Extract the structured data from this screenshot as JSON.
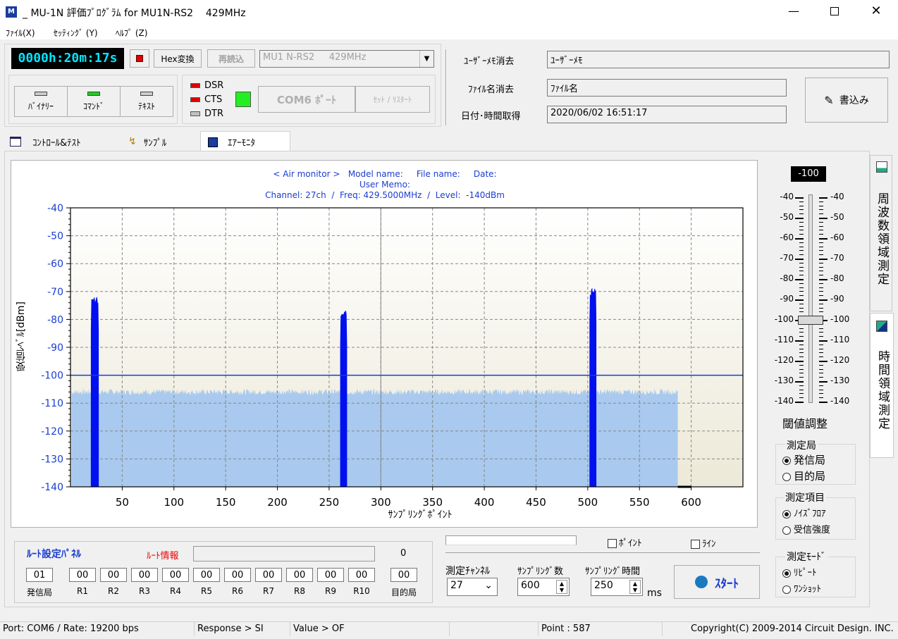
{
  "window": {
    "title": "_ MU-1N 評価ﾌﾟﾛｸﾞﾗﾑ for MU1N-RS2    429MHz"
  },
  "menu": [
    "ﾌｧｲﾙ(X)",
    "ｾｯﾃｨﾝｸﾞ (Y)",
    "ﾍﾙﾌﾟ (Z)"
  ],
  "toolbar": {
    "timer": "0000h:20m:17s",
    "hex_label": "Hex変換",
    "reload_label": "再読込",
    "device_select": "MU1 N-RS2     429MHz"
  },
  "modes": [
    {
      "label": "ﾊﾞｲﾅﾘｰ",
      "color": "#cccccc"
    },
    {
      "label": "ｺﾏﾝﾄﾞ",
      "color": "#22cc22"
    },
    {
      "label": "ﾃｷｽﾄ",
      "color": "#cccccc"
    }
  ],
  "signals": [
    {
      "label": "DSR",
      "color": "#dd0000"
    },
    {
      "label": "CTS",
      "color": "#dd0000"
    },
    {
      "label": "DTR",
      "color": "#c0c0c0"
    }
  ],
  "port": {
    "com_label": "COM6 ﾎﾟｰﾄ",
    "reset_label": "ｾｯﾄ / ﾘｽﾀｰﾄ",
    "cts_indicator": "#22ee22"
  },
  "info": {
    "memo_clear": "ﾕｰｻﾞｰﾒﾓ消去",
    "memo_value": "ﾕｰｻﾞｰﾒﾓ",
    "file_clear": "ﾌｧｲﾙ名消去",
    "file_value": "ﾌｧｲﾙ名",
    "date_label": "日付･時間取得",
    "date_value": "2020/06/02 16:51:17",
    "write_label": "書込み"
  },
  "tabs": [
    "ｺﾝﾄﾛｰﾙ&ﾃｽﾄ",
    "ｻﾝﾌﾟﾙ",
    "ｴｱｰﾓﾆﾀ"
  ],
  "side_tabs": [
    "周波数領域測定",
    "時間領域測定"
  ],
  "chart_data": {
    "type": "bar",
    "header_line1": "< Air monitor >   Model name:     File name:     Date:",
    "header_line2": "User Memo:",
    "header_line3": "Channel: 27ch  /  Freq: 429.5000MHz  /  Level:  -140dBm",
    "ylabel": "受信ﾚﾍﾞﾙ[dBm]",
    "xlabel": "ｻﾝﾌﾟﾘﾝｸﾞﾎﾟｲﾝﾄ",
    "ylim": [
      -140,
      -40
    ],
    "xlim": [
      0,
      650
    ],
    "yticks": [
      "-40",
      "-50",
      "-60",
      "-70",
      "-80",
      "-90",
      "-100",
      "-110",
      "-120",
      "-130",
      "-140"
    ],
    "xticks": [
      "50",
      "100",
      "150",
      "200",
      "250",
      "300",
      "350",
      "400",
      "450",
      "500",
      "550",
      "600"
    ],
    "threshold": -100,
    "noise_range": [
      1,
      587
    ],
    "noise_floor": -106,
    "peaks": [
      {
        "x": [
          20,
          27
        ],
        "level": -72
      },
      {
        "x": [
          261,
          267
        ],
        "level": -77
      },
      {
        "x": [
          502,
          508
        ],
        "level": -69
      }
    ]
  },
  "threshold": {
    "value": "-100",
    "ticks": [
      "-40",
      "-50",
      "-60",
      "-70",
      "-80",
      "-90",
      "-100",
      "-110",
      "-120",
      "-130",
      "-140"
    ],
    "label": "閾値調整"
  },
  "station": {
    "title": "測定局",
    "options": [
      "発信局",
      "目的局"
    ]
  },
  "item": {
    "title": "測定項目",
    "options": [
      "ﾉｲｽﾞﾌﾛｱ",
      "受信強度"
    ]
  },
  "mode": {
    "title": "測定ﾓｰﾄﾞ",
    "options": [
      "ﾘﾋﾟｰﾄ",
      "ﾜﾝｼｮｯﾄ"
    ]
  },
  "route": {
    "title": "ﾙｰﾄ設定ﾊﾟﾈﾙ",
    "info_label": "ﾙｰﾄ情報",
    "count": "0",
    "src": "01",
    "src_label": "発信局",
    "relays": [
      "00",
      "00",
      "00",
      "00",
      "00",
      "00",
      "00",
      "00",
      "00",
      "00"
    ],
    "relay_labels": [
      "R1",
      "R2",
      "R3",
      "R4",
      "R5",
      "R6",
      "R7",
      "R8",
      "R9",
      "R10"
    ],
    "dst": "00",
    "dst_label": "目的局"
  },
  "measure": {
    "point_label": "ﾎﾟｲﾝﾄ",
    "line_label": "ﾗｲﾝ",
    "channel_label": "測定ﾁｬﾝﾈﾙ",
    "channel_value": "27",
    "count_label": "ｻﾝﾌﾟﾘﾝｸﾞ数",
    "count_value": "600",
    "time_label": "ｻﾝﾌﾟﾘﾝｸﾞ時間",
    "time_value": "250",
    "ms": "ms",
    "start_label": "ｽﾀｰﾄ"
  },
  "status": [
    "Port: COM6 / Rate: 19200 bps",
    "Response > SI",
    "Value > OF",
    "",
    "Point : 587",
    "Copyright(C) 2009-2014 Circuit Design. INC."
  ]
}
